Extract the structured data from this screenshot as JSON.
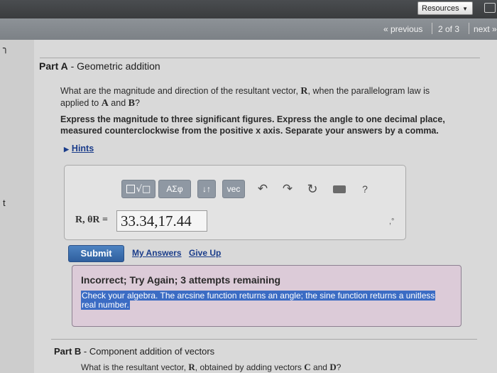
{
  "header": {
    "resources_label": "Resources",
    "nav_previous": "« previous",
    "nav_page": "2 of 3",
    "nav_next": "next »"
  },
  "part_a": {
    "title_prefix": "Part A",
    "title_sep": " - ",
    "title_text": "Geometric addition",
    "question_1": "What are the magnitude and direction of the resultant vector, ",
    "vec_r": "R",
    "question_2": ", when the parallelogram law is applied to ",
    "vec_a": "A",
    "question_3": " and ",
    "vec_b": "B",
    "question_4": "?",
    "instructions": "Express the magnitude to three significant figures. Express the angle to one decimal place, measured counterclockwise from the positive x axis. Separate your answers by a comma.",
    "hints_label": "Hints",
    "toolbar": {
      "greek_label": "ΑΣφ",
      "sort_label": "↓↑",
      "vec_label": "vec",
      "undo_glyph": "↶",
      "redo_glyph": "↷",
      "reset_glyph": "↻",
      "help_label": "?"
    },
    "answer_prefix": "R, θR =",
    "answer_value": "33.34,17.44",
    "unit_mark": ",°",
    "submit_label": "Submit",
    "my_answers_label": "My Answers",
    "give_up_label": "Give Up",
    "feedback_title": "Incorrect; Try Again; 3 attempts remaining",
    "feedback_message": "Check your algebra. The arcsine function returns an angle; the sine function returns a unitless real number."
  },
  "part_b": {
    "title_prefix": "Part B",
    "title_sep": " - ",
    "title_text": "Component addition of vectors",
    "question_1": "What is the resultant vector, ",
    "vec_r": "R",
    "question_2": ", obtained by adding vectors ",
    "vec_c": "C",
    "question_3": " and ",
    "vec_d": "D",
    "question_4": "?"
  },
  "margin_glyphs": [
    "╮",
    "t"
  ],
  "colors": {
    "link": "#1a3c8a",
    "submit": "#3a6aaa",
    "feedback_bg": "#dccbd8",
    "highlight": "#3b6cc4"
  }
}
